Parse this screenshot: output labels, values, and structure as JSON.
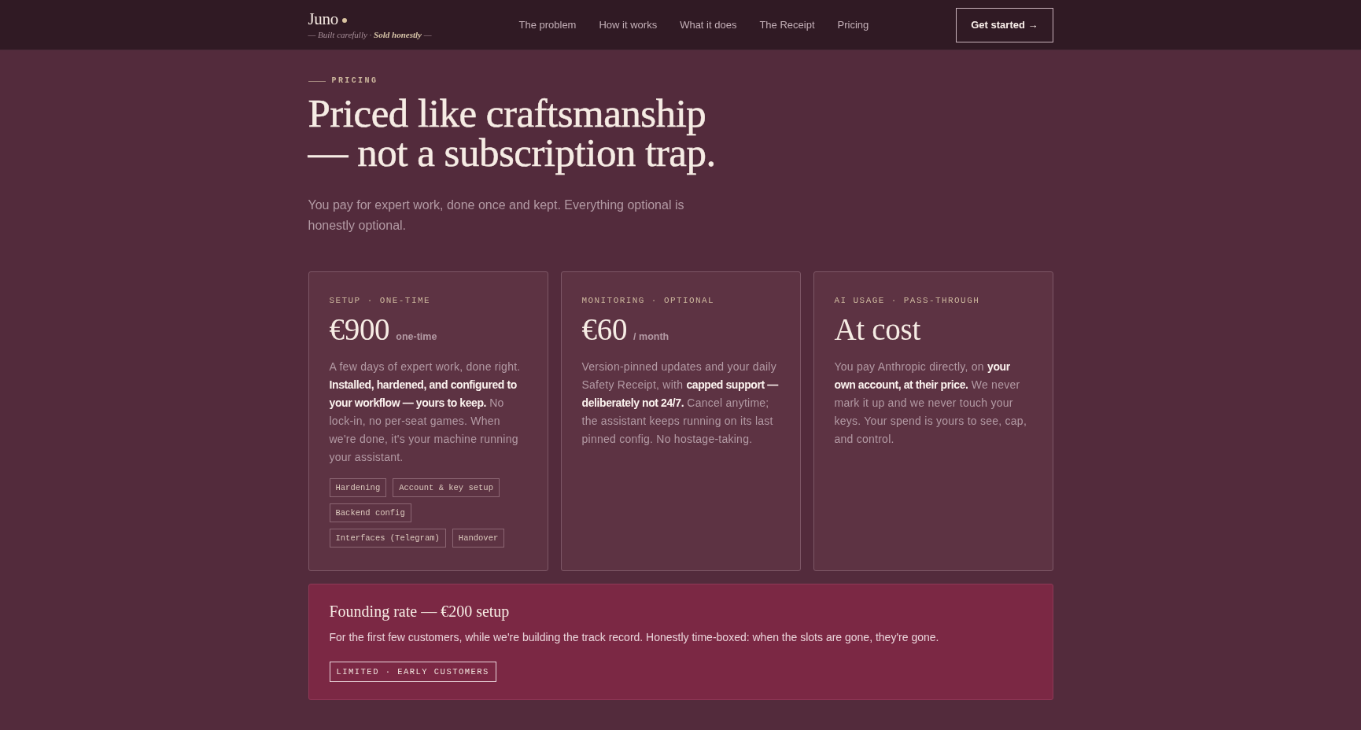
{
  "header": {
    "logo": {
      "wordmark": "Juno",
      "tagline": "— Built carefully · **Sold honestly** —"
    },
    "nav": [
      "The problem",
      "How it works",
      "What it does",
      "The Receipt",
      "Pricing"
    ],
    "cta": "Get started →"
  },
  "pricing": {
    "eyebrow": "PRICING",
    "title_lines": [
      "Priced like craftsmanship",
      "— not a subscription trap."
    ],
    "subtitle": "You pay for expert work, done once and kept. Everything optional is honestly optional.",
    "cards": [
      {
        "label": "SETUP · ONE-TIME",
        "price": "€900",
        "unit": "one-time",
        "description": "A few days of expert work, done right. **Installed, hardened, and configured to your workflow — yours to keep.** No lock-in, no per-seat games. When we're done, it's your machine running your assistant.",
        "tags": [
          "Hardening",
          "Account & key setup",
          "Backend config",
          "Interfaces (Telegram)",
          "Handover"
        ]
      },
      {
        "label": "MONITORING · OPTIONAL",
        "price": "€60",
        "unit": "/ month",
        "description": "Version-pinned updates and your daily Safety Receipt, with **capped support — deliberately not 24/7.** Cancel anytime; the assistant keeps running on its last pinned config. No hostage-taking."
      },
      {
        "label": "AI USAGE · PASS-THROUGH",
        "price": "At cost",
        "description": "You pay Anthropic directly, on **your own account, at their price.** We never mark it up and we never touch your keys. Your spend is yours to see, cap, and control."
      }
    ],
    "founding": {
      "title": "Founding rate — €200 setup",
      "description": "For the first few customers, while we're building the track record. Honestly time-boxed: when the slots are gone, they're gone.",
      "badge": "LIMITED · EARLY CUSTOMERS"
    }
  }
}
